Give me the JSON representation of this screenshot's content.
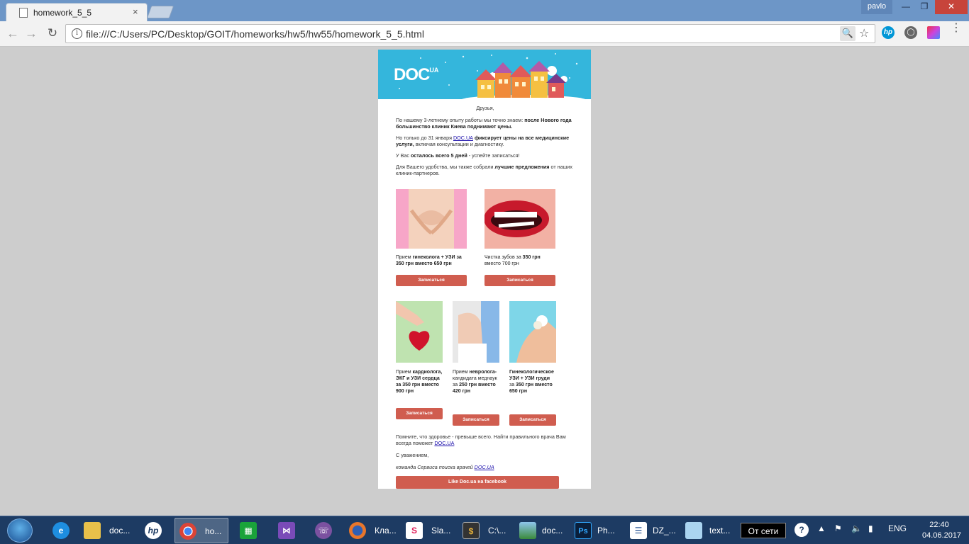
{
  "browser": {
    "tab_title": "homework_5_5",
    "tab_close": "×",
    "user_name": "pavlo",
    "url": "file:///C:/Users/PC/Desktop/GOIT/homeworks/hw5/hw55/homework_5_5.html",
    "icons": {
      "back": "arrow-left-icon",
      "forward": "arrow-right-icon",
      "reload": "reload-icon",
      "info": "info-icon",
      "zoom": "zoom-icon",
      "star": "star-icon",
      "menu": "menu-icon"
    },
    "ext_hp": "hp",
    "win": {
      "min": "—",
      "max": "❐",
      "close": "✕"
    }
  },
  "email": {
    "logo": "DOC",
    "logo_sup": "UA",
    "greeting": "Друзья,",
    "p1_a": "По нашему 3-летнему опыту работы мы точно знаем: ",
    "p1_b": "после Нового года большинство клиник Киева поднимают цены.",
    "p2_a": "Но только до 31 января ",
    "p2_link": "DOC.UA",
    "p2_b": " фиксирует цены на все медицинские услуги,",
    "p2_c": " включая консультации и диагностику.",
    "p3_a": "У Вас ",
    "p3_b": "осталось всего 5 дней",
    "p3_c": " - успейте записаться!",
    "p4_a": "Для Вашего удобства, мы также собрали ",
    "p4_b": "лучшие предложения",
    "p4_c": " от наших клиник-партнеров.",
    "offers_top": [
      {
        "caption_a": "Прием ",
        "caption_b": "гинеколога + УЗИ за 350 грн вместо 650 грн",
        "button": "Записаться"
      },
      {
        "caption_a": "Чистка зубов за ",
        "caption_b": "350 грн",
        "caption_c": " вместо 700 грн",
        "button": "Записаться"
      }
    ],
    "offers_bottom": [
      {
        "caption_a": "Прием ",
        "caption_b": "кардиолога, ЭКГ и УЗИ сердца за 350 грн вместо 900 грн",
        "button": "Записаться"
      },
      {
        "caption_a": "Прием ",
        "caption_b": "невролога-",
        "caption_c": "кандидата меднаук за ",
        "caption_d": "250 грн вместо 420 грн",
        "button": "Записаться"
      },
      {
        "caption_a": "",
        "caption_b": "Гинекологическое УЗИ + УЗИ груди",
        "caption_c": " за ",
        "caption_d": "350 грн вместо 650 грн",
        "button": "Записаться"
      }
    ],
    "footer_p1_a": "Помните, что здоровье - превыше всего. Найти правильного врача Вам всегда поможет ",
    "footer_p1_link": "DOC.UA",
    "footer_regards": "С уважением,",
    "footer_team_a": "команда Сервиса поиска врачей ",
    "footer_team_link": "DOC.UA",
    "fb_button": "Like Doc.ua на facebook"
  },
  "taskbar": {
    "items": [
      {
        "label": "doc...",
        "icon": "folder-icon"
      },
      {
        "label": "",
        "icon": "hp-icon"
      },
      {
        "label": "ho...",
        "icon": "chrome-icon"
      },
      {
        "label": "",
        "icon": "store-icon"
      },
      {
        "label": "",
        "icon": "vs-icon"
      },
      {
        "label": "",
        "icon": "viber-icon"
      },
      {
        "label": "Кла...",
        "icon": "firefox-icon"
      },
      {
        "label": "Sla...",
        "icon": "slack-icon"
      },
      {
        "label": "C:\\...",
        "icon": "terminal-icon"
      },
      {
        "label": "doc...",
        "icon": "image-viewer-icon"
      },
      {
        "label": "Ph...",
        "icon": "photoshop-icon"
      },
      {
        "label": "DZ_...",
        "icon": "word-icon"
      },
      {
        "label": "text...",
        "icon": "notepad-icon"
      }
    ],
    "status": "От сети",
    "lang": "ENG",
    "time": "22:40",
    "date": "04.06.2017"
  }
}
